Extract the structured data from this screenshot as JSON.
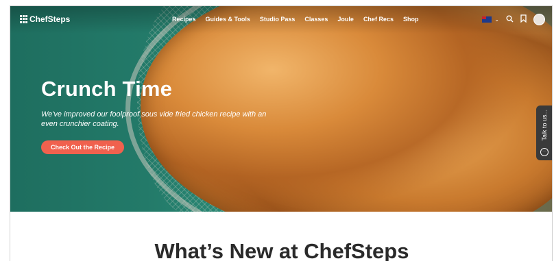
{
  "brand": {
    "name": "ChefSteps"
  },
  "nav": {
    "items": [
      {
        "label": "Recipes"
      },
      {
        "label": "Guides & Tools"
      },
      {
        "label": "Studio Pass"
      },
      {
        "label": "Classes"
      },
      {
        "label": "Joule"
      },
      {
        "label": "Chef Recs"
      },
      {
        "label": "Shop"
      }
    ],
    "icons": {
      "flag": "australia-flag-icon",
      "chevron": "chevron-down-icon",
      "search": "search-icon",
      "bookmark": "bookmark-icon",
      "avatar": "avatar"
    }
  },
  "hero": {
    "title": "Crunch Time",
    "subtitle": "We've improved our foolproof sous vide fried chicken recipe with an even crunchier coating.",
    "cta_label": "Check Out the Recipe",
    "cta_color": "#f0614e"
  },
  "chat": {
    "label": "Talk to us..."
  },
  "section": {
    "title": "What’s New at ChefSteps"
  }
}
